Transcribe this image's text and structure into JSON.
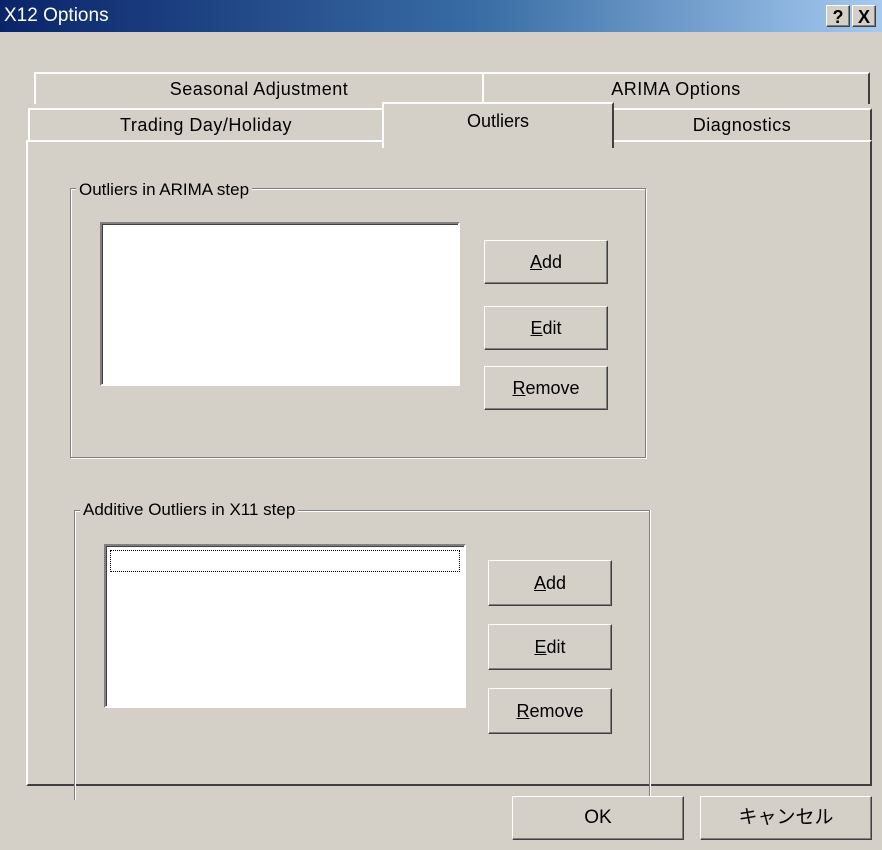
{
  "window": {
    "title": "X12 Options",
    "help_button": "?",
    "close_button": "X"
  },
  "tabs": {
    "row_back": [
      "Seasonal Adjustment",
      "ARIMA Options"
    ],
    "row_front": [
      "Trading Day/Holiday",
      "Outliers",
      "Diagnostics"
    ],
    "active": "Outliers"
  },
  "arima_group": {
    "label": "Outliers in ARIMA step",
    "add": {
      "mnemonic": "A",
      "rest": "dd"
    },
    "edit": {
      "mnemonic": "E",
      "rest": "dit"
    },
    "remove": {
      "mnemonic": "R",
      "rest": "emove"
    }
  },
  "x11_group": {
    "label": "Additive Outliers in X11 step",
    "add": {
      "mnemonic": "A",
      "rest": "dd"
    },
    "edit": {
      "mnemonic": "E",
      "rest": "dit"
    },
    "remove": {
      "mnemonic": "R",
      "rest": "emove"
    }
  },
  "footer": {
    "ok": "OK",
    "cancel": "キャンセル"
  }
}
